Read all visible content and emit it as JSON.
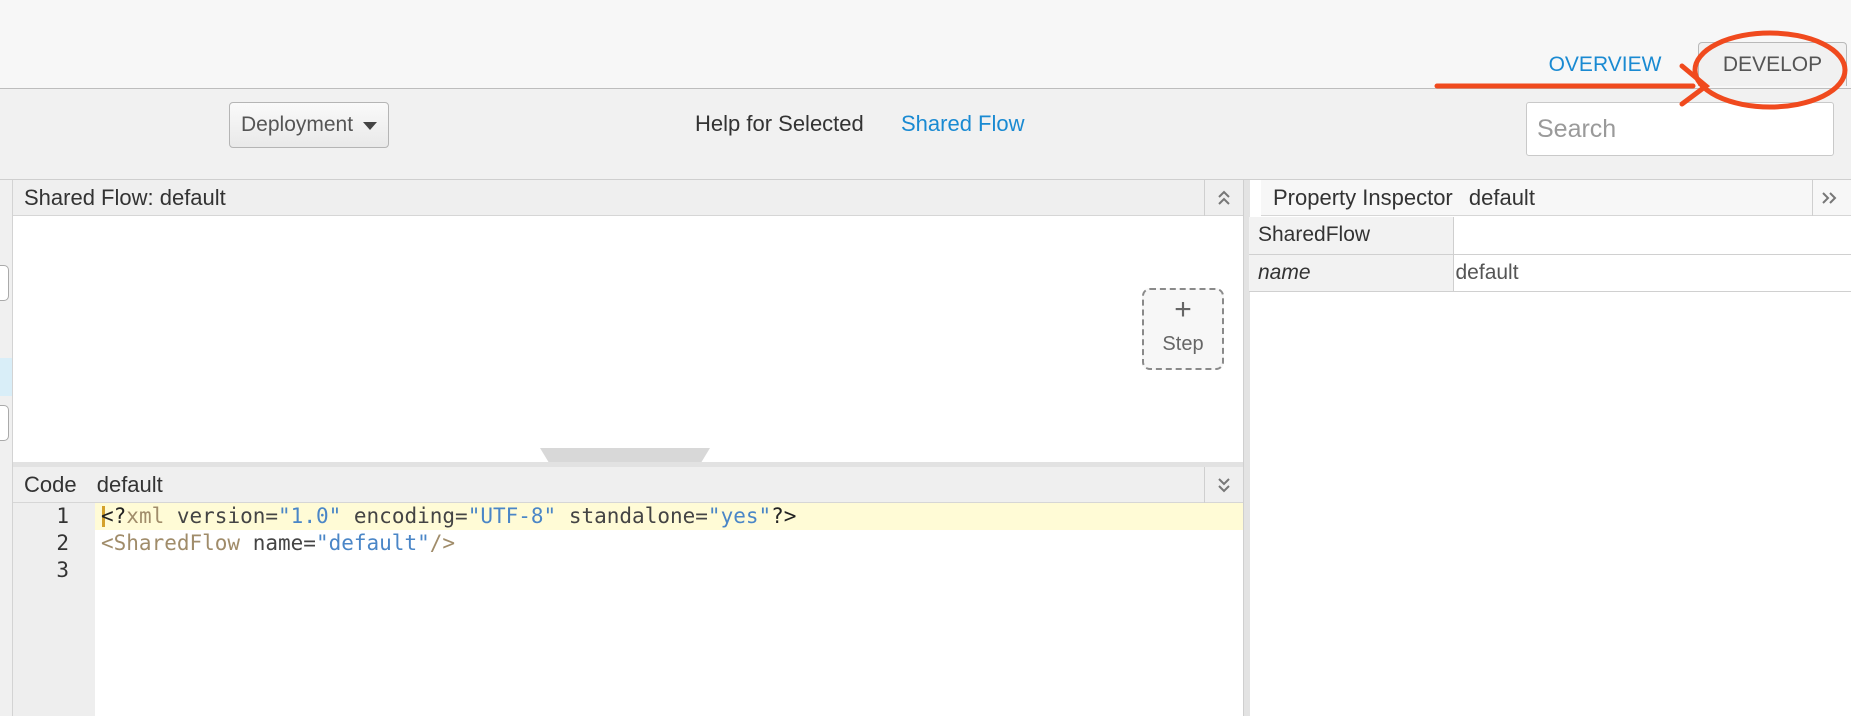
{
  "header": {
    "tabs": [
      {
        "label": "OVERVIEW",
        "active": false
      },
      {
        "label": "DEVELOP",
        "active": true
      }
    ]
  },
  "toolbar": {
    "deployment_label": "Deployment",
    "help_label": "Help for Selected",
    "help_link": "Shared Flow",
    "search_placeholder": "Search"
  },
  "flow_panel": {
    "title": "Shared Flow: default",
    "step": {
      "plus": "+",
      "label": "Step"
    }
  },
  "code_panel": {
    "title": "Code",
    "name": "default",
    "line_numbers": [
      "1",
      "2",
      "3"
    ],
    "lines": [
      [
        {
          "t": "<?",
          "c": "punc"
        },
        {
          "t": "xml",
          "c": "tag"
        },
        {
          "t": " version=",
          "c": "attr"
        },
        {
          "t": "\"1.0\"",
          "c": "str"
        },
        {
          "t": " encoding=",
          "c": "attr"
        },
        {
          "t": "\"UTF-8\"",
          "c": "str"
        },
        {
          "t": " standalone=",
          "c": "attr"
        },
        {
          "t": "\"yes\"",
          "c": "str"
        },
        {
          "t": "?>",
          "c": "punc"
        }
      ],
      [
        {
          "t": "<SharedFlow",
          "c": "tag"
        },
        {
          "t": " name=",
          "c": "attr"
        },
        {
          "t": "\"default\"",
          "c": "str"
        },
        {
          "t": "/>",
          "c": "tag"
        }
      ],
      []
    ]
  },
  "property_inspector": {
    "title": "Property Inspector",
    "name": "default",
    "rows": [
      {
        "key": "SharedFlow",
        "value": ""
      },
      {
        "key": "name",
        "value": "default"
      }
    ]
  },
  "colors": {
    "accent_link": "#1a8ad2",
    "annotation": "#f04a1e",
    "active_line": "#fffbd6"
  },
  "icons": {
    "collapse": "double-chevron-up-icon",
    "expand_code": "double-chevron-down-icon",
    "inspector_expand": "double-chevron-right-icon",
    "dropdown": "caret-down-icon"
  }
}
